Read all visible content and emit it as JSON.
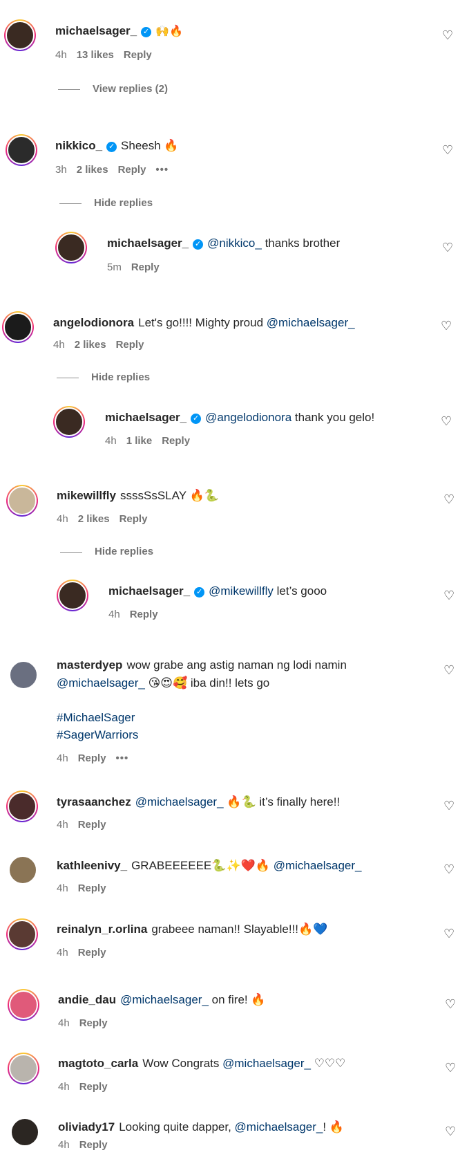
{
  "comments": [
    {
      "user": "michaelsager_",
      "text": "🙌🔥",
      "time": "4h",
      "likes": "13 likes",
      "reply": "Reply",
      "view_replies": "View replies (2)"
    },
    {
      "user": "nikkico_",
      "text": "Sheesh 🔥",
      "time": "3h",
      "likes": "2 likes",
      "reply": "Reply",
      "more": "•••",
      "hide": "Hide replies",
      "child": {
        "user": "michaelsager_",
        "mention": "@nikkico_",
        "text": "thanks brother",
        "time": "5m",
        "reply": "Reply"
      }
    },
    {
      "user": "angelodionora",
      "text": "Let's go!!!! Mighty proud",
      "mention": "@michaelsager_",
      "time": "4h",
      "likes": "2 likes",
      "reply": "Reply",
      "hide": "Hide replies",
      "child": {
        "user": "michaelsager_",
        "mention": "@angelodionora",
        "text": "thank you gelo!",
        "time": "4h",
        "likes": "1 like",
        "reply": "Reply"
      }
    },
    {
      "user": "mikewillfly",
      "text": "ssssSsSLAY 🔥🐍",
      "time": "4h",
      "likes": "2 likes",
      "reply": "Reply",
      "hide": "Hide replies",
      "child": {
        "user": "michaelsager_",
        "mention": "@mikewillfly",
        "text": "let’s gooo",
        "time": "4h",
        "reply": "Reply"
      }
    },
    {
      "user": "masterdyep",
      "text": "wow grabe ang astig naman ng lodi namin",
      "mention": "@michaelsager_",
      "text2": "😘😍🥰 iba din!! lets go",
      "tag1": "#MichaelSager",
      "tag2": "#SagerWarriors",
      "time": "4h",
      "reply": "Reply",
      "more": "•••"
    },
    {
      "user": "tyrasaanchez",
      "mention": "@michaelsager_",
      "text": "🔥🐍 it’s finally here!!",
      "time": "4h",
      "reply": "Reply"
    },
    {
      "user": "kathleenivy_",
      "text": "GRABEEEEEE🐍✨❤️🔥",
      "mention": "@michaelsager_",
      "time": "4h",
      "reply": "Reply"
    },
    {
      "user": "reinalyn_r.orlina",
      "text": "grabeee naman!! Slayable!!!🔥💙",
      "time": "4h",
      "reply": "Reply"
    },
    {
      "user": "andie_dau",
      "mention": "@michaelsager_",
      "text": "on fire! 🔥",
      "time": "4h",
      "reply": "Reply"
    },
    {
      "user": "magtoto_carla",
      "text": "Wow Congrats",
      "mention": "@michaelsager_",
      "text2": "♡♡♡",
      "time": "4h",
      "reply": "Reply"
    },
    {
      "user": "oliviady17",
      "text": "Looking quite dapper,",
      "mention": "@michaelsager_",
      "text2": "! 🔥",
      "time": "4h",
      "reply": "Reply"
    }
  ],
  "icons": {
    "heart": "heart-icon",
    "verified": "verified-badge-icon"
  },
  "glyphs": {
    "heart": "♡",
    "check": "✓"
  },
  "colors": {
    "mention": "#00376b",
    "verified": "#0095f6",
    "muted": "#737373"
  }
}
